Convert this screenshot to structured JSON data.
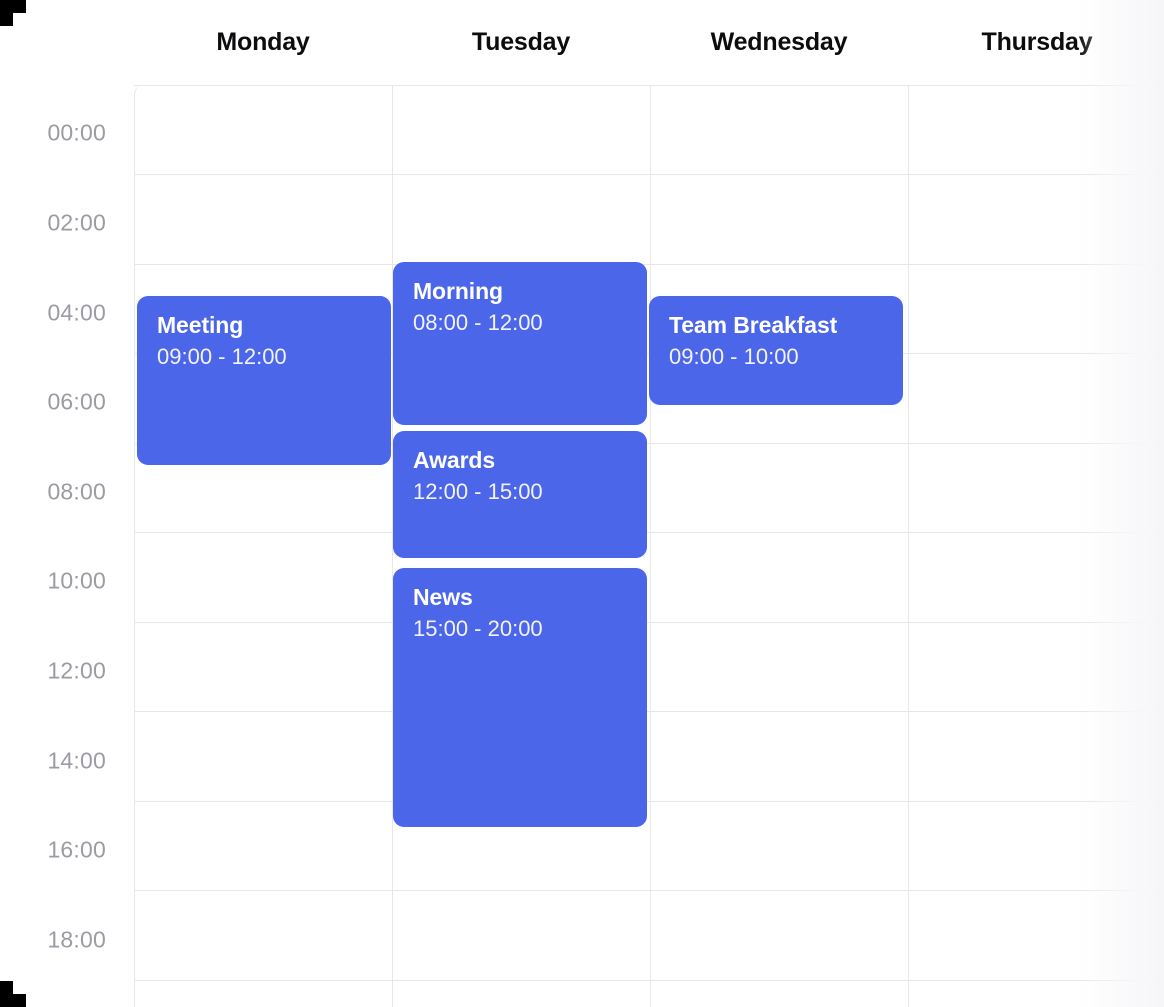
{
  "view": {
    "type": "week-timeline",
    "accent_color": "#4c66ea",
    "grid_line_color": "#e6e6eb",
    "time_label_color": "#9b9ba3",
    "header_text_color": "#0d0d0f",
    "background_color": "#ffffff"
  },
  "header": {
    "days": [
      {
        "label": "Monday"
      },
      {
        "label": "Tuesday"
      },
      {
        "label": "Wednesday"
      },
      {
        "label": "Thursday"
      }
    ]
  },
  "time_axis": {
    "labels": [
      "00:00",
      "02:00",
      "04:00",
      "06:00",
      "08:00",
      "10:00",
      "12:00",
      "14:00",
      "16:00",
      "18:00"
    ],
    "interval_hours": 2,
    "start": "00:00",
    "end": "20:00"
  },
  "events": [
    {
      "title": "Meeting",
      "time": "09:00 - 12:00",
      "day": "Monday",
      "day_index": 0,
      "start": "09:00",
      "end": "12:00",
      "color": "#4c66ea"
    },
    {
      "title": "Morning",
      "time": "08:00 - 12:00",
      "day": "Tuesday",
      "day_index": 1,
      "start": "08:00",
      "end": "12:00",
      "color": "#4c66ea"
    },
    {
      "title": "Awards",
      "time": "12:00 - 15:00",
      "day": "Tuesday",
      "day_index": 1,
      "start": "12:00",
      "end": "15:00",
      "color": "#4c66ea"
    },
    {
      "title": "News",
      "time": "15:00 - 20:00",
      "day": "Tuesday",
      "day_index": 1,
      "start": "15:00",
      "end": "20:00",
      "color": "#4c66ea"
    },
    {
      "title": "Team Breakfast",
      "time": "09:00 - 10:00",
      "day": "Wednesday",
      "day_index": 2,
      "start": "09:00",
      "end": "10:00",
      "color": "#4c66ea"
    }
  ]
}
